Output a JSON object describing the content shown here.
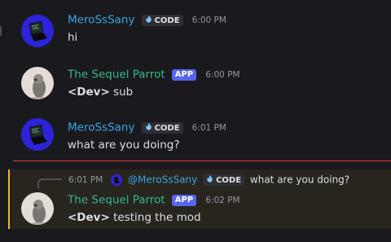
{
  "messages": [
    {
      "author": "MeroSsSany",
      "tag": "CODE",
      "time": "6:00 PM",
      "text": "hi"
    },
    {
      "author": "The Sequel Parrot",
      "tag": "APP",
      "time": "6:00 PM",
      "prefix": "<Dev>",
      "text": "sub"
    },
    {
      "author": "MeroSsSany",
      "tag": "CODE",
      "time": "6:01 PM",
      "text": "what are you doing?"
    },
    {
      "author": "The Sequel Parrot",
      "tag": "APP",
      "time": "6:02 PM",
      "prefix": "<Dev>",
      "text": "testing the mod",
      "reply": {
        "time": "6:01 PM",
        "author": "@MeroSsSany",
        "tag": "CODE",
        "text": "what are you doing?"
      }
    }
  ],
  "colors": {
    "background": "#1a1a1e",
    "mero_name": "#3aa4e4",
    "parrot_name": "#35b68a",
    "app_tag": "#5865f2",
    "new_messages_divider": "#e2403f",
    "mention_highlight_border": "#f0b232"
  },
  "icons": {
    "code_tag_icon": "flame-icon",
    "mero_avatar": "laptop-icon",
    "parrot_avatar": "parrot-photo"
  }
}
